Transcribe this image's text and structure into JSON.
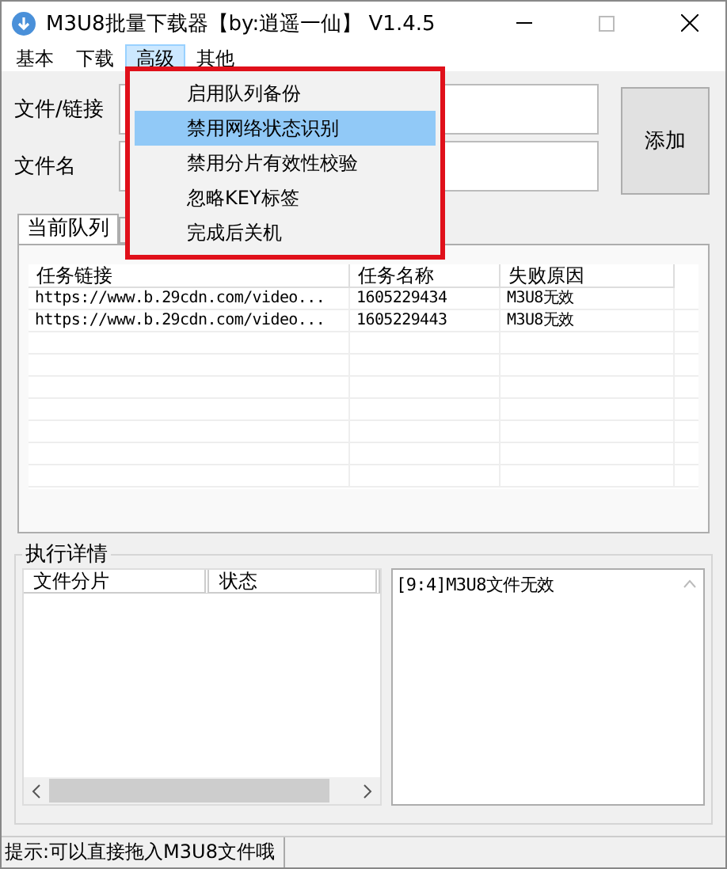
{
  "window": {
    "title": "M3U8批量下载器【by:逍遥一仙】 V1.4.5"
  },
  "menu_bar": [
    {
      "label": "基本",
      "selected": false
    },
    {
      "label": "下载",
      "selected": false
    },
    {
      "label": "高级",
      "selected": true
    },
    {
      "label": "其他",
      "selected": false
    }
  ],
  "dropdown": {
    "items": [
      {
        "label": "启用队列备份",
        "selected": false
      },
      {
        "label": "禁用网络状态识别",
        "selected": true
      },
      {
        "label": "禁用分片有效性校验",
        "selected": false
      },
      {
        "label": "忽略KEY标签",
        "selected": false
      },
      {
        "label": "完成后关机",
        "selected": false
      }
    ]
  },
  "form": {
    "fields": [
      {
        "label": "文件/链接"
      },
      {
        "label": "文件名"
      }
    ],
    "add_button": "添加"
  },
  "tabs": [
    {
      "label": "当前队列",
      "selected": true
    }
  ],
  "queue_table": {
    "columns": [
      "任务链接",
      "任务名称",
      "失败原因"
    ],
    "rows": [
      [
        "https://www.b.29cdn.com/video...",
        "1605229434",
        "M3U8无效"
      ],
      [
        "https://www.b.29cdn.com/video...",
        "1605229443",
        "M3U8无效"
      ]
    ]
  },
  "details": {
    "title": "执行详情",
    "columns": [
      "文件分片",
      "状态"
    ],
    "log": [
      "[9:4]M3U8文件无效"
    ]
  },
  "status_bar": "提示:可以直接拖入M3U8文件哦"
}
